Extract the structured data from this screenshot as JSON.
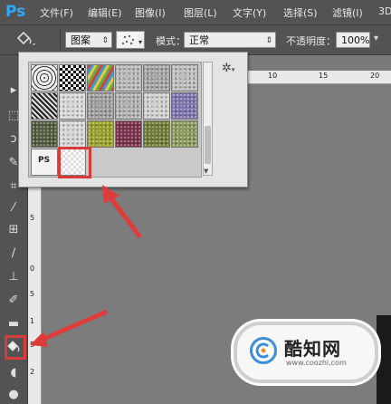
{
  "app": {
    "logo": "Ps"
  },
  "menu": [
    "文件(F)",
    "编辑(E)",
    "图像(I)",
    "图层(L)",
    "文字(Y)",
    "选择(S)",
    "滤镜(I)",
    "3D"
  ],
  "options": {
    "fill_source": "图案",
    "mode_label": "模式：",
    "mode_value": "正常",
    "opacity_label": "不透明度：",
    "opacity_value": "100%"
  },
  "ruler": {
    "h": [
      "10",
      "15",
      "20"
    ],
    "v": [
      "5",
      "0",
      "5",
      "1",
      "5",
      "2"
    ]
  },
  "pattern_picker": {
    "patterns": [
      {
        "name": "pattern-concentric",
        "color": "#dcdcdc"
      },
      {
        "name": "pattern-checker",
        "color": "#333333"
      },
      {
        "name": "pattern-multicolor",
        "color": "#6a5aa0"
      },
      {
        "name": "pattern-cloud",
        "color": "#b8b8b8"
      },
      {
        "name": "pattern-gray-stone",
        "color": "#a4a4a4"
      },
      {
        "name": "pattern-crumple",
        "color": "#bcbcbc"
      },
      {
        "name": "pattern-zigzag",
        "color": "#444444"
      },
      {
        "name": "pattern-white-noise",
        "color": "#d8d8d8"
      },
      {
        "name": "pattern-gray-cloud",
        "color": "#9e9e9e"
      },
      {
        "name": "pattern-gray-texture",
        "color": "#b0b0b0"
      },
      {
        "name": "pattern-marble",
        "color": "#cfcfcf"
      },
      {
        "name": "pattern-purple-texture",
        "color": "#7d74b0"
      },
      {
        "name": "pattern-moss",
        "color": "#4f5a3c"
      },
      {
        "name": "pattern-fuzz",
        "color": "#d6d6d6"
      },
      {
        "name": "pattern-yellow-green",
        "color": "#9aa025"
      },
      {
        "name": "pattern-purple-red",
        "color": "#7a2d4a"
      },
      {
        "name": "pattern-olive",
        "color": "#6f7a32"
      },
      {
        "name": "pattern-green-gray",
        "color": "#8a9a5a"
      },
      {
        "name": "pattern-custom",
        "color": "#f2f2f2"
      },
      {
        "name": "pattern-transparent",
        "color": "#eeeeee"
      }
    ],
    "custom_label": "PS",
    "highlight_color": "#d93a3a"
  },
  "watermark": {
    "name": "酷知网",
    "url": "www.coozhi.com"
  }
}
